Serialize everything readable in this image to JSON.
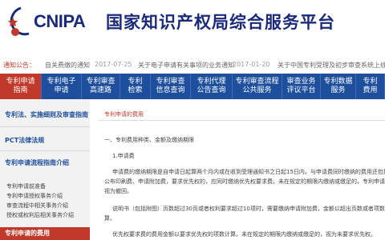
{
  "header": {
    "logo_text": "CNIPA",
    "site_title": "国家知识产权局综合服务平台"
  },
  "notice": {
    "label": "通知公告：",
    "items": [
      {
        "text": "自关费缴的通知",
        "date": "2017-07-25"
      },
      {
        "text": "关于电子申请有关事项的业务通知",
        "date": "2017-01-20"
      },
      {
        "text": "关于中国专利受理及初步审查系统上线",
        "date": ""
      }
    ]
  },
  "nav": [
    {
      "line1": "专利申请",
      "line2": "指南"
    },
    {
      "line1": "专利电子",
      "line2": "申请"
    },
    {
      "line1": "专利审查",
      "line2": "高速路"
    },
    {
      "line1": "专利",
      "line2": "检索"
    },
    {
      "line1": "专利审查",
      "line2": "信息查询"
    },
    {
      "line1": "专利代理",
      "line2": "公告查询"
    },
    {
      "line1": "专利审查流程",
      "line2": "公共服务"
    },
    {
      "line1": "审查业务",
      "line2": "评议平台"
    },
    {
      "line1": "专利数据",
      "line2": "服务"
    },
    {
      "line1": "专利",
      "line2": "费用"
    }
  ],
  "sidebar": {
    "item1": "专利法、实施细则及审查指南",
    "item2": "PCT法律法规",
    "item3": "专利申请流程指南介绍",
    "subs": [
      "专利申请前准备",
      "专利申请授权事务介绍",
      "审查流程中相关事务介绍",
      "授权或权利后相关事务介绍"
    ],
    "active": "专利申请的费用"
  },
  "content": {
    "breadcrumb": "专利申请的费用",
    "heading": "一、专利费用种类、金额及缴纳期限",
    "sub": "1.申请费",
    "para1": "申请费的缴纳期限是自申请日起算两个月内或在收到受理通知书之日起15日内。与申请费同时缴纳的费用还包括",
    "para2": "公布印刷费、申请附加费，要求优先权的，应同时缴纳优先权要求费。未在规定的期限内缴纳或缴足的，专利申请将",
    "para3": "视为撤回。",
    "para4": "说明书（包括附图）页数超过30页或者权利要求超过10项时，需要缴纳申请附加费，金额以超出页数或者项数计",
    "para5": "算。",
    "para6": "优先权要求费的费用金额以要求优先权的项数计算。未在规定的期限内缴纳或缴足的，视为未要求优先权。"
  }
}
